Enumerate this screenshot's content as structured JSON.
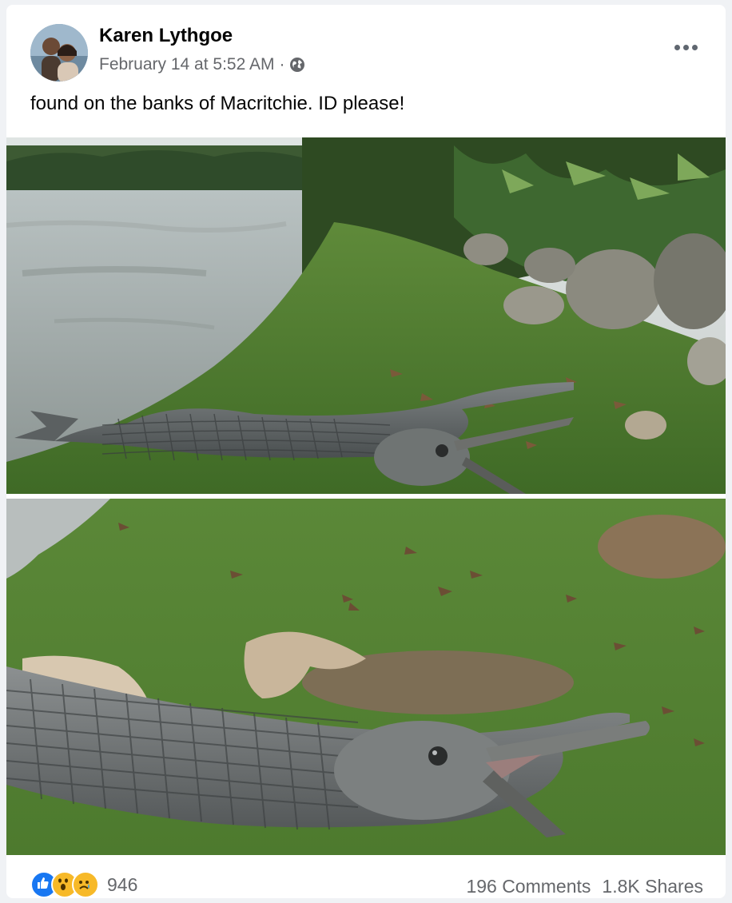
{
  "post": {
    "author": "Karen Lythgoe",
    "date": "February 14 at 5:52 AM",
    "separator": "·",
    "privacy_icon": "globe-icon",
    "more_icon": "more-options-icon",
    "text": "found on the banks of Macritchie. ID please!",
    "photos": [
      {
        "name": "photo-fish-on-riverbank"
      },
      {
        "name": "photo-fish-closeup"
      }
    ]
  },
  "footer": {
    "reaction_icons": [
      "like-icon",
      "wow-icon",
      "sad-icon"
    ],
    "reaction_count": "946",
    "comments": "196 Comments",
    "shares": "1.8K Shares"
  },
  "colors": {
    "like_blue": "#1877f2",
    "reaction_yellow": "#f7b928",
    "secondary_text": "#65676b"
  }
}
